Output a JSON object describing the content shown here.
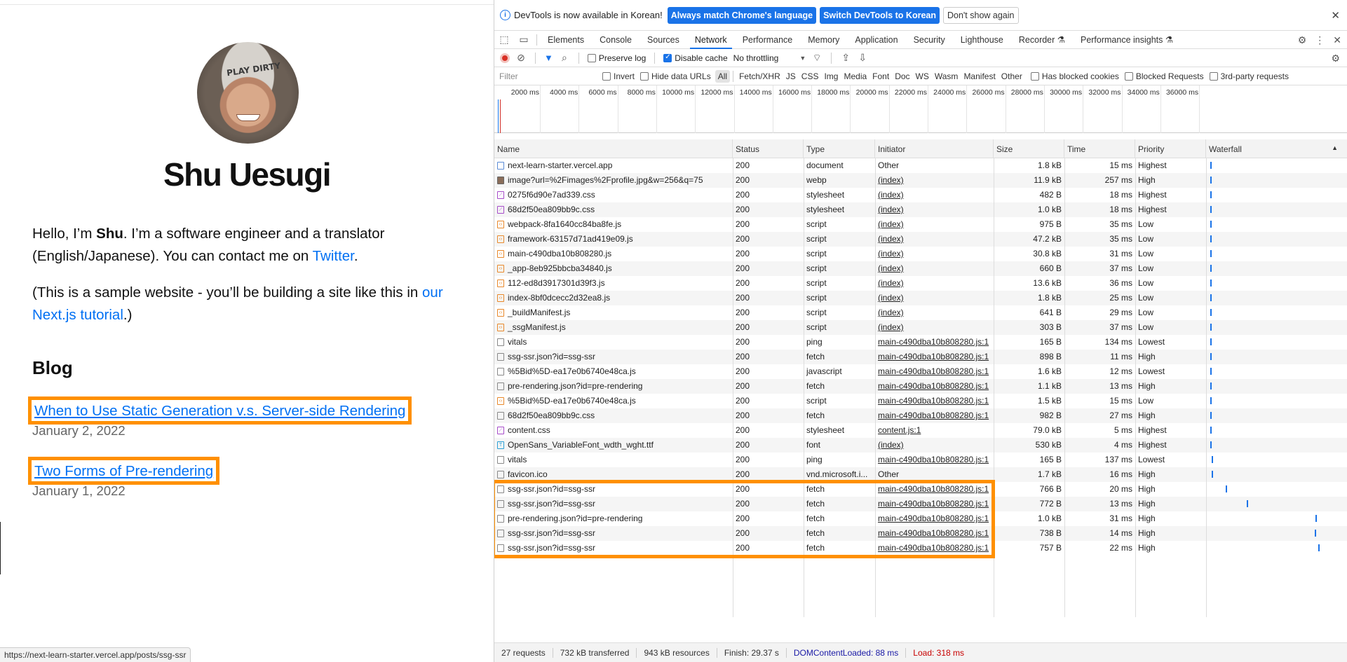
{
  "page": {
    "site_title": "Shu Uesugi",
    "avatar_cap_text": "PLAY DIRTY",
    "intro_hello": "Hello, I’m ",
    "intro_name": "Shu",
    "intro_rest": ". I’m a software engineer and a translator (English/Japanese). You can contact me on ",
    "intro_link": "Twitter",
    "intro_end": ".",
    "sample_text": "(This is a sample website - you’ll be building a site like this in ",
    "sample_link": "our Next.js tutorial",
    "sample_end": ".)",
    "blog_heading": "Blog",
    "posts": [
      {
        "title": "When to Use Static Generation v.s. Server-side Rendering",
        "date": "January 2, 2022"
      },
      {
        "title": "Two Forms of Pre-rendering",
        "date": "January 1, 2022"
      }
    ],
    "status_url": "https://next-learn-starter.vercel.app/posts/ssg-ssr"
  },
  "devtools": {
    "infobar": {
      "message": "DevTools is now available in Korean!",
      "btn_match": "Always match Chrome's language",
      "btn_switch": "Switch DevTools to Korean",
      "btn_dismiss": "Don't show again"
    },
    "tabs": [
      "Elements",
      "Console",
      "Sources",
      "Network",
      "Performance",
      "Memory",
      "Application",
      "Security",
      "Lighthouse",
      "Recorder ⚗",
      "Performance insights ⚗"
    ],
    "active_tab": "Network",
    "toolbar": {
      "preserve_log": "Preserve log",
      "disable_cache": "Disable cache",
      "throttling": "No throttling"
    },
    "filterbar": {
      "placeholder": "Filter",
      "invert": "Invert",
      "hide_data_urls": "Hide data URLs",
      "types": [
        "All",
        "Fetch/XHR",
        "JS",
        "CSS",
        "Img",
        "Media",
        "Font",
        "Doc",
        "WS",
        "Wasm",
        "Manifest",
        "Other"
      ],
      "has_blocked_cookies": "Has blocked cookies",
      "blocked_requests": "Blocked Requests",
      "third_party": "3rd-party requests"
    },
    "overview_ticks": [
      "2000 ms",
      "4000 ms",
      "6000 ms",
      "8000 ms",
      "10000 ms",
      "12000 ms",
      "14000 ms",
      "16000 ms",
      "18000 ms",
      "20000 ms",
      "22000 ms",
      "24000 ms",
      "26000 ms",
      "28000 ms",
      "30000 ms",
      "32000 ms",
      "34000 ms",
      "36000 ms"
    ],
    "columns": [
      "Name",
      "Status",
      "Type",
      "Initiator",
      "Size",
      "Time",
      "Priority",
      "Waterfall"
    ],
    "rows": [
      {
        "icon": "doc",
        "name": "next-learn-starter.vercel.app",
        "status": "200",
        "type": "document",
        "initiator": "Other",
        "link": false,
        "size": "1.8 kB",
        "time": "15 ms",
        "priority": "Highest"
      },
      {
        "icon": "img",
        "name": "image?url=%2Fimages%2Fprofile.jpg&w=256&q=75",
        "status": "200",
        "type": "webp",
        "initiator": "(index)",
        "link": true,
        "size": "11.9 kB",
        "time": "257 ms",
        "priority": "High"
      },
      {
        "icon": "css",
        "name": "0275f6d90e7ad339.css",
        "status": "200",
        "type": "stylesheet",
        "initiator": "(index)",
        "link": true,
        "size": "482 B",
        "time": "18 ms",
        "priority": "Highest"
      },
      {
        "icon": "css",
        "name": "68d2f50ea809bb9c.css",
        "status": "200",
        "type": "stylesheet",
        "initiator": "(index)",
        "link": true,
        "size": "1.0 kB",
        "time": "18 ms",
        "priority": "Highest"
      },
      {
        "icon": "js",
        "name": "webpack-8fa1640cc84ba8fe.js",
        "status": "200",
        "type": "script",
        "initiator": "(index)",
        "link": true,
        "size": "975 B",
        "time": "35 ms",
        "priority": "Low"
      },
      {
        "icon": "js",
        "name": "framework-63157d71ad419e09.js",
        "status": "200",
        "type": "script",
        "initiator": "(index)",
        "link": true,
        "size": "47.2 kB",
        "time": "35 ms",
        "priority": "Low"
      },
      {
        "icon": "js",
        "name": "main-c490dba10b808280.js",
        "status": "200",
        "type": "script",
        "initiator": "(index)",
        "link": true,
        "size": "30.8 kB",
        "time": "31 ms",
        "priority": "Low"
      },
      {
        "icon": "js",
        "name": "_app-8eb925bbcba34840.js",
        "status": "200",
        "type": "script",
        "initiator": "(index)",
        "link": true,
        "size": "660 B",
        "time": "37 ms",
        "priority": "Low"
      },
      {
        "icon": "js",
        "name": "112-ed8d3917301d39f3.js",
        "status": "200",
        "type": "script",
        "initiator": "(index)",
        "link": true,
        "size": "13.6 kB",
        "time": "36 ms",
        "priority": "Low"
      },
      {
        "icon": "js",
        "name": "index-8bf0dcecc2d32ea8.js",
        "status": "200",
        "type": "script",
        "initiator": "(index)",
        "link": true,
        "size": "1.8 kB",
        "time": "25 ms",
        "priority": "Low"
      },
      {
        "icon": "js",
        "name": "_buildManifest.js",
        "status": "200",
        "type": "script",
        "initiator": "(index)",
        "link": true,
        "size": "641 B",
        "time": "29 ms",
        "priority": "Low"
      },
      {
        "icon": "js",
        "name": "_ssgManifest.js",
        "status": "200",
        "type": "script",
        "initiator": "(index)",
        "link": true,
        "size": "303 B",
        "time": "37 ms",
        "priority": "Low"
      },
      {
        "icon": "other",
        "name": "vitals",
        "status": "200",
        "type": "ping",
        "initiator": "main-c490dba10b808280.js:1",
        "link": true,
        "size": "165 B",
        "time": "134 ms",
        "priority": "Lowest"
      },
      {
        "icon": "other",
        "name": "ssg-ssr.json?id=ssg-ssr",
        "status": "200",
        "type": "fetch",
        "initiator": "main-c490dba10b808280.js:1",
        "link": true,
        "size": "898 B",
        "time": "11 ms",
        "priority": "High"
      },
      {
        "icon": "other",
        "name": "%5Bid%5D-ea17e0b6740e48ca.js",
        "status": "200",
        "type": "javascript",
        "initiator": "main-c490dba10b808280.js:1",
        "link": true,
        "size": "1.6 kB",
        "time": "12 ms",
        "priority": "Lowest"
      },
      {
        "icon": "other",
        "name": "pre-rendering.json?id=pre-rendering",
        "status": "200",
        "type": "fetch",
        "initiator": "main-c490dba10b808280.js:1",
        "link": true,
        "size": "1.1 kB",
        "time": "13 ms",
        "priority": "High"
      },
      {
        "icon": "js",
        "name": "%5Bid%5D-ea17e0b6740e48ca.js",
        "status": "200",
        "type": "script",
        "initiator": "main-c490dba10b808280.js:1",
        "link": true,
        "size": "1.5 kB",
        "time": "15 ms",
        "priority": "Low"
      },
      {
        "icon": "other",
        "name": "68d2f50ea809bb9c.css",
        "status": "200",
        "type": "fetch",
        "initiator": "main-c490dba10b808280.js:1",
        "link": true,
        "size": "982 B",
        "time": "27 ms",
        "priority": "High"
      },
      {
        "icon": "css",
        "name": "content.css",
        "status": "200",
        "type": "stylesheet",
        "initiator": "content.js:1",
        "link": true,
        "size": "79.0 kB",
        "time": "5 ms",
        "priority": "Highest"
      },
      {
        "icon": "font",
        "name": "OpenSans_VariableFont_wdth_wght.ttf",
        "status": "200",
        "type": "font",
        "initiator": "(index)",
        "link": true,
        "size": "530 kB",
        "time": "4 ms",
        "priority": "Highest"
      },
      {
        "icon": "other",
        "name": "vitals",
        "status": "200",
        "type": "ping",
        "initiator": "main-c490dba10b808280.js:1",
        "link": true,
        "size": "165 B",
        "time": "137 ms",
        "priority": "Lowest"
      },
      {
        "icon": "other",
        "name": "favicon.ico",
        "status": "200",
        "type": "vnd.microsoft.i...",
        "initiator": "Other",
        "link": false,
        "size": "1.7 kB",
        "time": "16 ms",
        "priority": "High"
      },
      {
        "icon": "other",
        "name": "ssg-ssr.json?id=ssg-ssr",
        "status": "200",
        "type": "fetch",
        "initiator": "main-c490dba10b808280.js:1",
        "link": true,
        "size": "766 B",
        "time": "20 ms",
        "priority": "High"
      },
      {
        "icon": "other",
        "name": "ssg-ssr.json?id=ssg-ssr",
        "status": "200",
        "type": "fetch",
        "initiator": "main-c490dba10b808280.js:1",
        "link": true,
        "size": "772 B",
        "time": "13 ms",
        "priority": "High"
      },
      {
        "icon": "other",
        "name": "pre-rendering.json?id=pre-rendering",
        "status": "200",
        "type": "fetch",
        "initiator": "main-c490dba10b808280.js:1",
        "link": true,
        "size": "1.0 kB",
        "time": "31 ms",
        "priority": "High"
      },
      {
        "icon": "other",
        "name": "ssg-ssr.json?id=ssg-ssr",
        "status": "200",
        "type": "fetch",
        "initiator": "main-c490dba10b808280.js:1",
        "link": true,
        "size": "738 B",
        "time": "14 ms",
        "priority": "High"
      },
      {
        "icon": "other",
        "name": "ssg-ssr.json?id=ssg-ssr",
        "status": "200",
        "type": "fetch",
        "initiator": "main-c490dba10b808280.js:1",
        "link": true,
        "size": "757 B",
        "time": "22 ms",
        "priority": "High"
      }
    ],
    "statusbar": {
      "requests": "27 requests",
      "transferred": "732 kB transferred",
      "resources": "943 kB resources",
      "finish": "Finish: 29.37 s",
      "dcl": "DOMContentLoaded: 88 ms",
      "load": "Load: 318 ms"
    },
    "colors": {
      "accent": "#1a73e8",
      "highlight": "#ff9000",
      "link": "#0070f3",
      "load": "#c80000",
      "dcl": "#1a1aa6"
    }
  }
}
